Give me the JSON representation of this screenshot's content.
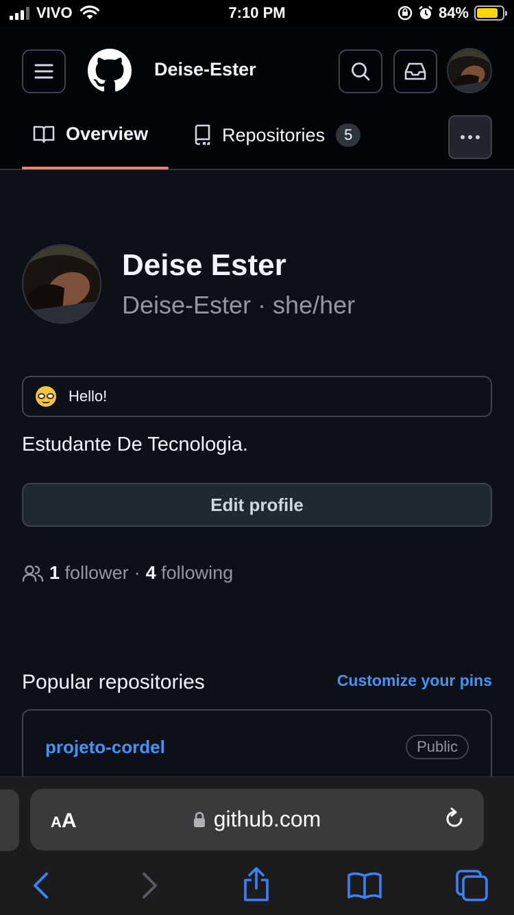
{
  "status_bar": {
    "carrier": "VIVO",
    "time": "7:10 PM",
    "battery_percent": "84%",
    "battery_level": 0.84
  },
  "header": {
    "username": "Deise-Ester",
    "menu_icon": "hamburger-icon",
    "logo_icon": "github-logo-icon",
    "search_icon": "search-icon",
    "inbox_icon": "inbox-icon"
  },
  "tabs": [
    {
      "label": "Overview",
      "icon": "book-icon",
      "active": true
    },
    {
      "label": "Repositories",
      "icon": "repo-icon",
      "count": "5"
    }
  ],
  "profile": {
    "name": "Deise Ester",
    "handle": "Deise-Ester · she/her",
    "status_text": "Hello!",
    "bio": "Estudante De Tecnologia.",
    "edit_label": "Edit profile",
    "followers_count": "1",
    "followers_label": "follower",
    "separator": "·",
    "following_count": "4",
    "following_label": "following"
  },
  "popular": {
    "title": "Popular repositories",
    "customize_label": "Customize your pins",
    "repos": [
      {
        "name": "projeto-cordel",
        "visibility": "Public"
      }
    ]
  },
  "safari": {
    "aa_label": "AA",
    "url": "github.com"
  },
  "colors": {
    "background": "#0d1117",
    "header_bg": "#010409",
    "accent_link": "#4493f8",
    "tab_underline": "#f78166",
    "border": "#3d444d"
  }
}
